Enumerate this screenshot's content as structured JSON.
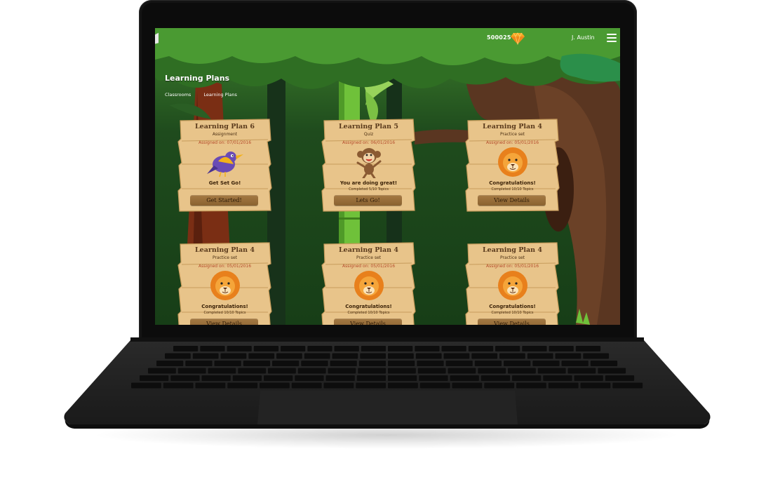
{
  "app": {
    "coins": "500025",
    "user_name": "J. Austin",
    "page_title": "Learning Plans",
    "breadcrumbs": [
      "Classrooms",
      "Learning Plans"
    ]
  },
  "icons": {
    "gem": "diamond-icon",
    "menu": "hamburger-menu-icon",
    "home": "home-icon"
  },
  "colors": {
    "accent_gem": "#f6a623",
    "board": "#e8c48a",
    "button": "#9a7038",
    "date_text": "#b44a2a"
  },
  "cards": [
    {
      "title": "Learning Plan 6",
      "subtitle": "Assignment",
      "date": "Assigned on: 07/01/2016",
      "animal": "bird",
      "message": "Get Set Go!",
      "progress": "",
      "button": "Get Started!"
    },
    {
      "title": "Learning Plan 5",
      "subtitle": "Quiz",
      "date": "Assigned on: 06/01/2016",
      "animal": "monkey",
      "message": "You are doing great!",
      "progress": "Completed 5/10 Topics",
      "button": "Lets Go!"
    },
    {
      "title": "Learning Plan 4",
      "subtitle": "Practice set",
      "date": "Assigned on: 05/01/2016",
      "animal": "lion",
      "message": "Congratulations!",
      "progress": "Completed 10/10 Topics",
      "button": "View Details"
    },
    {
      "title": "Learning Plan 4",
      "subtitle": "Practice set",
      "date": "Assigned on: 05/01/2016",
      "animal": "lion",
      "message": "Congratulations!",
      "progress": "Completed 10/10 Topics",
      "button": "View Details"
    },
    {
      "title": "Learning Plan 4",
      "subtitle": "Practice set",
      "date": "Assigned on: 05/01/2016",
      "animal": "lion",
      "message": "Congratulations!",
      "progress": "Completed 10/10 Topics",
      "button": "View Details"
    },
    {
      "title": "Learning Plan 4",
      "subtitle": "Practice set",
      "date": "Assigned on: 05/01/2016",
      "animal": "lion",
      "message": "Congratulations!",
      "progress": "Completed 10/10 Topics",
      "button": "View Details"
    }
  ]
}
